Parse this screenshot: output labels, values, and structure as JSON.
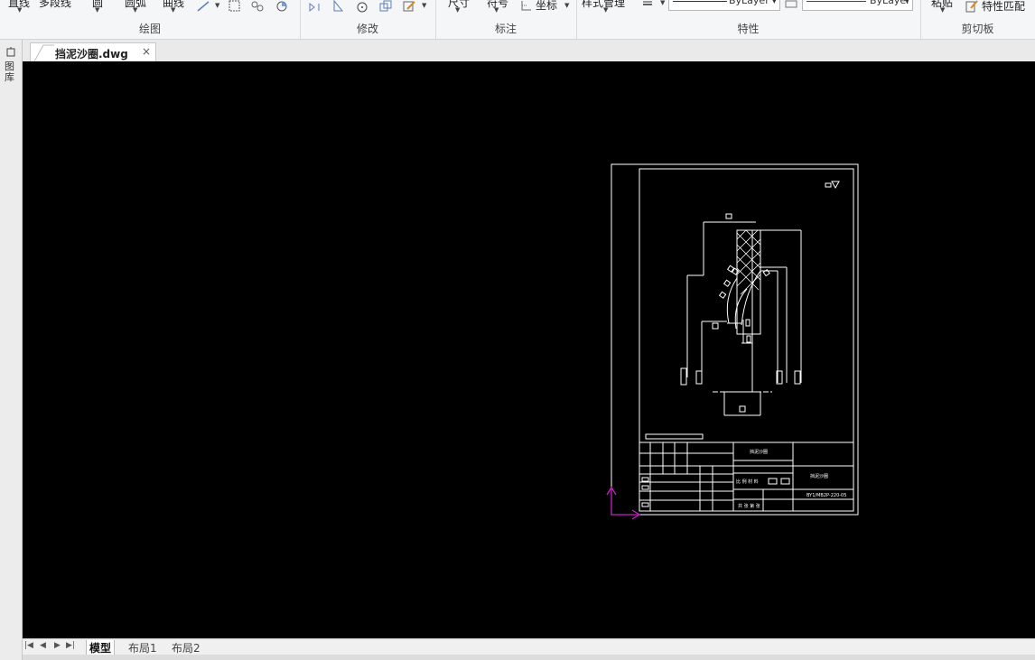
{
  "ribbon": {
    "groups": [
      {
        "caption": "绘图",
        "tools": [
          "直线",
          "多段线",
          "圆",
          "圆弧",
          "曲线"
        ]
      },
      {
        "caption": "修改"
      },
      {
        "caption": "标注",
        "tools": [
          "尺寸",
          "符号",
          "坐标"
        ]
      },
      {
        "caption": "特性",
        "tools": [
          "样式管理"
        ],
        "linetype": "ByLayer",
        "color": "ByLayer"
      },
      {
        "caption": "剪切板",
        "tools": [
          "粘贴",
          "特性匹配"
        ]
      }
    ]
  },
  "tabs": {
    "document": "挡泥沙圈.dwg",
    "close": "×"
  },
  "side_panel": {
    "label": "图库"
  },
  "layout_tabs": [
    "模型",
    "布局1",
    "布局2"
  ],
  "nav_buttons": [
    "|◀",
    "◀",
    "▶",
    "▶|"
  ],
  "drawing": {
    "title_cell": "挡泥沙圈",
    "name_cell": "挡泥沙圈",
    "drawing_number": "BY1/MB2P-220-05",
    "scale_row": "比 例 材 料",
    "signature_row": "共 张 第 张"
  },
  "colors": {
    "canvas": "#000000",
    "drawing_lines": "#ffffff",
    "ucs_axis": "#c51fc5",
    "color_swatch": "#e60000"
  }
}
